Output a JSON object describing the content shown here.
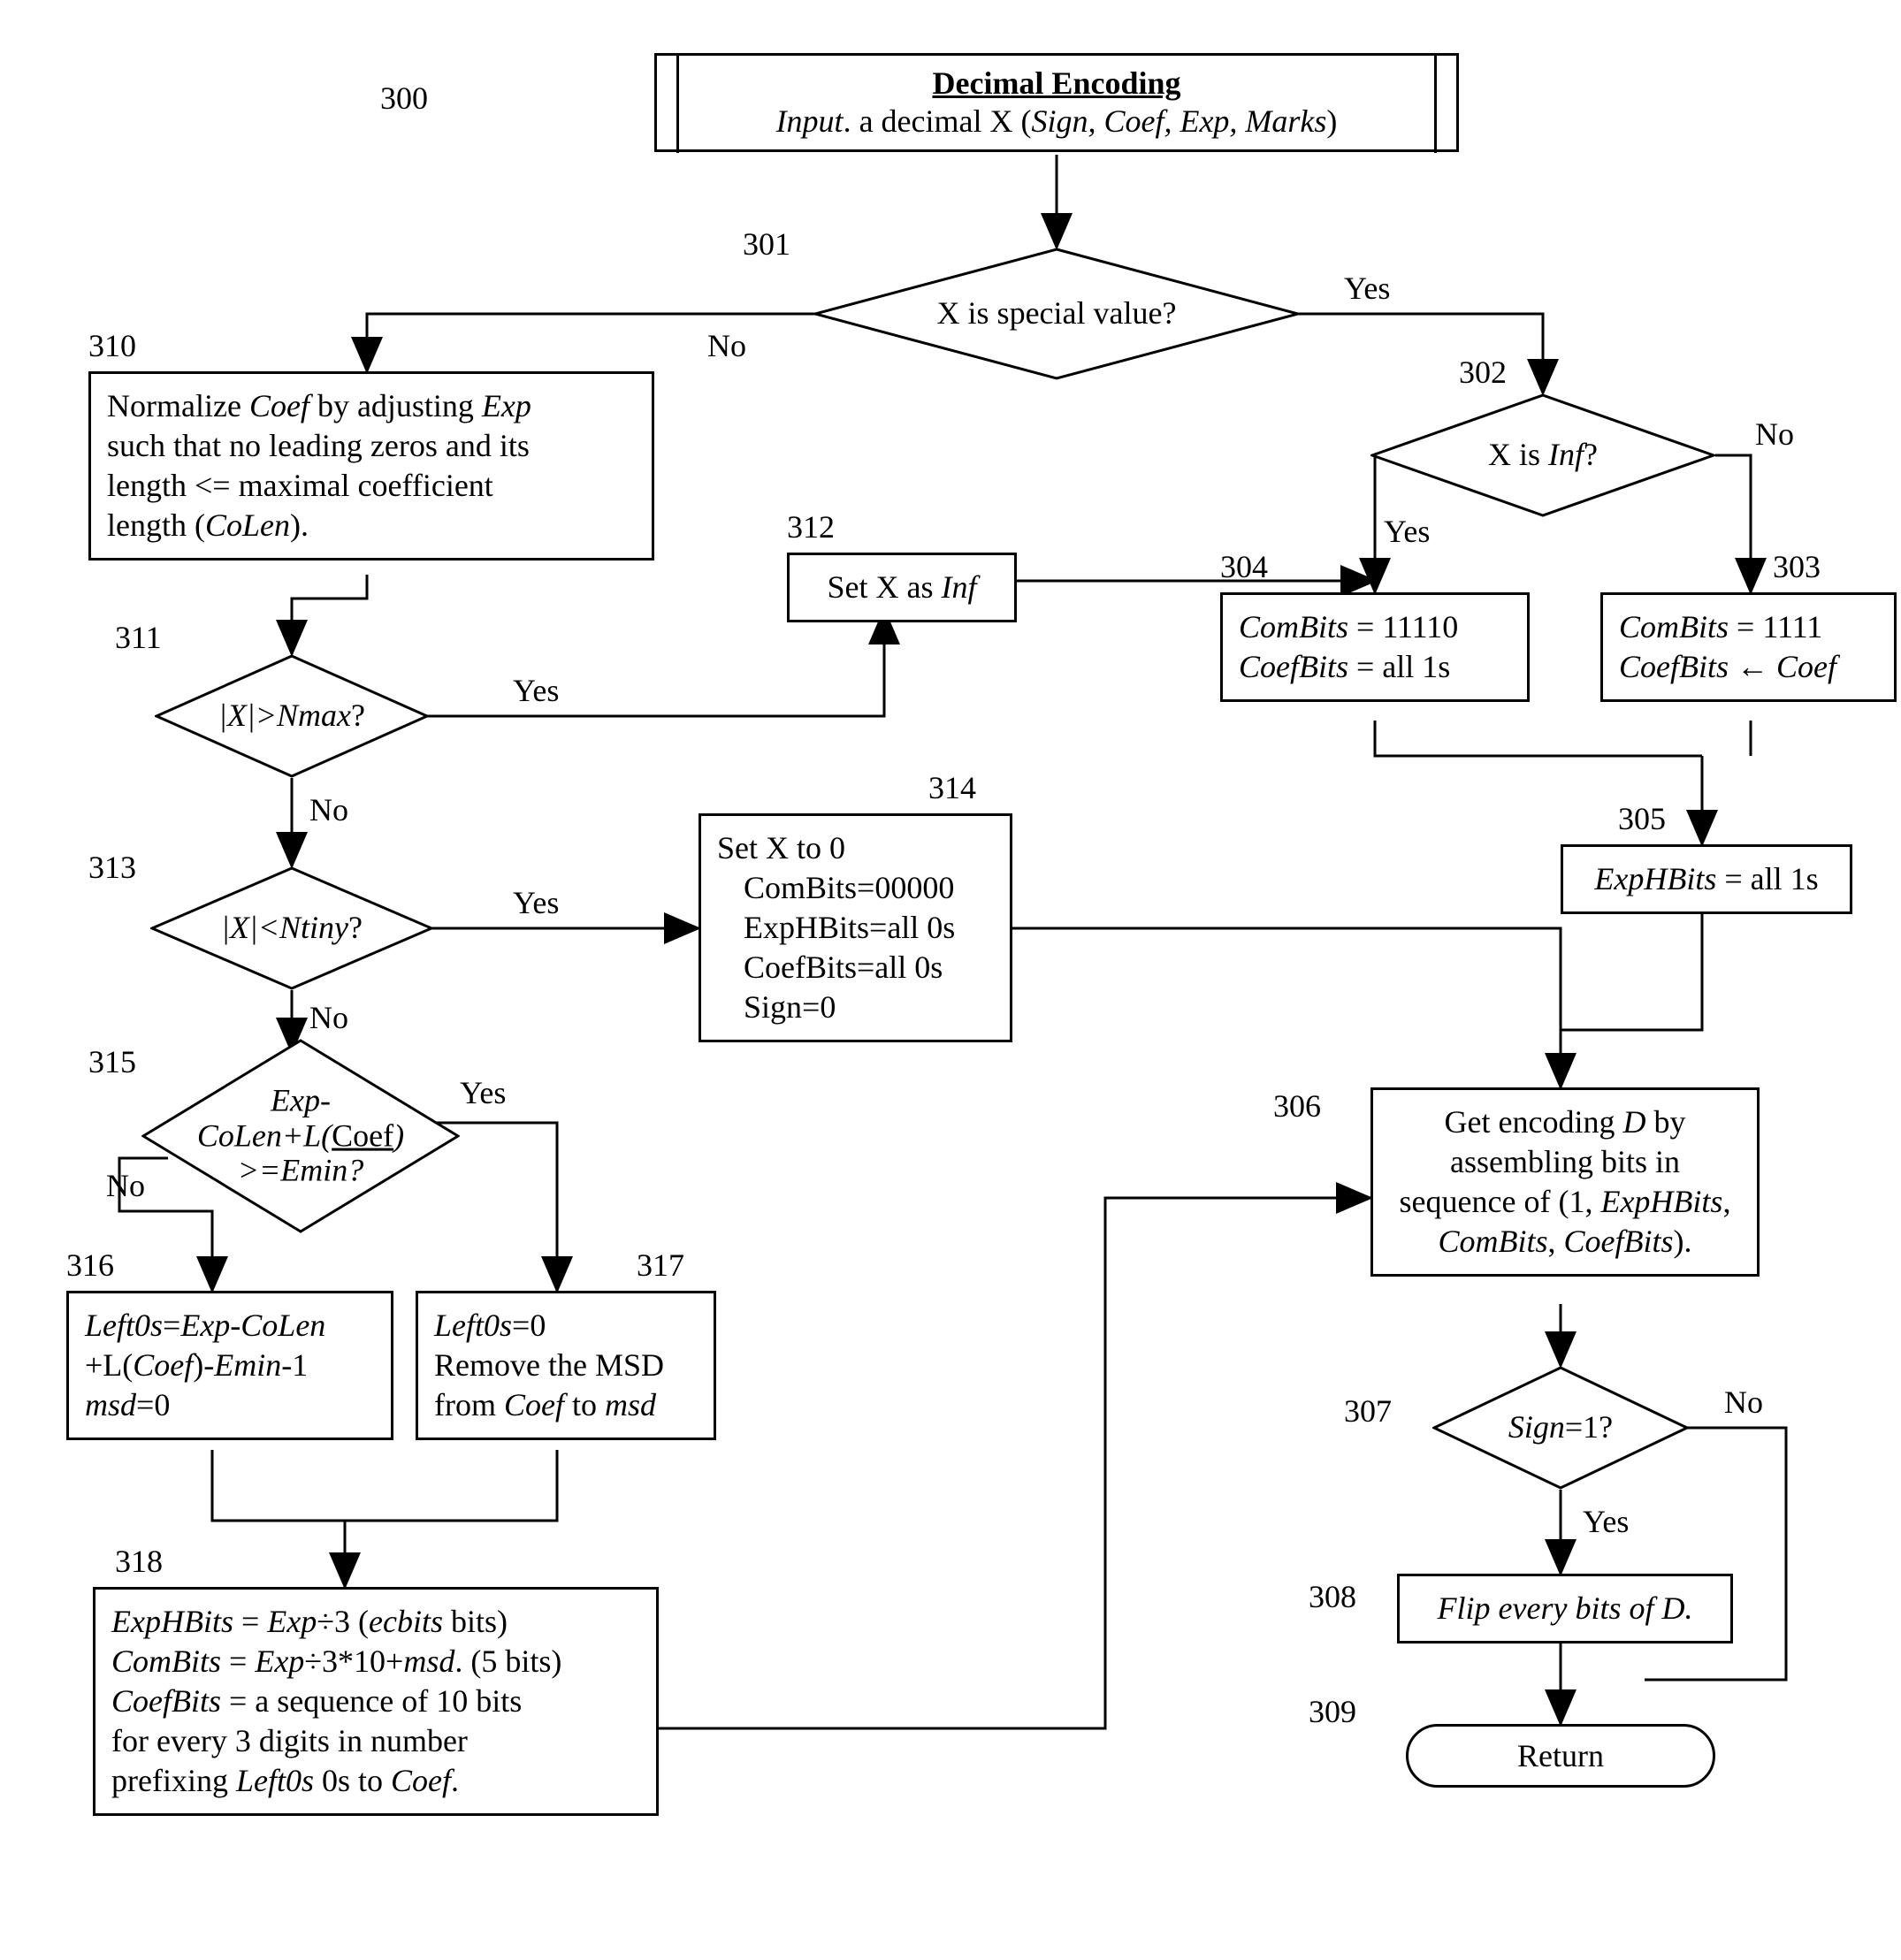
{
  "labels": {
    "n300": "300",
    "n301": "301",
    "n302": "302",
    "n303": "303",
    "n304": "304",
    "n305": "305",
    "n306": "306",
    "n307": "307",
    "n308": "308",
    "n309": "309",
    "n310": "310",
    "n311": "311",
    "n312": "312",
    "n313": "313",
    "n314": "314",
    "n315": "315",
    "n316": "316",
    "n317": "317",
    "n318": "318"
  },
  "start": {
    "title": "Decimal  Encoding",
    "input_prefix": "Input",
    "input_rest": ". a decimal X (",
    "input_params": "Sign, Coef, Exp, Marks",
    "input_close": ")"
  },
  "d301": {
    "text": "X is special value?"
  },
  "d302": {
    "text_pre": "X is ",
    "text_inf": "Inf",
    "text_q": "?"
  },
  "p304": {
    "l1a": "ComBits",
    "l1b": " = 11110",
    "l2a": "CoefBits",
    "l2b": " = all 1s"
  },
  "p303": {
    "l1a": "ComBits",
    "l1b": " = 1111",
    "l2a": "CoefBits",
    "l2arrow": " ←  ",
    "l2c": "Coef"
  },
  "p305": {
    "a": "ExpHBits",
    "b": " = all 1s"
  },
  "p306": {
    "t1": "Get encoding ",
    "t1i": "D",
    "t1b": " by",
    "t2": "assembling bits in",
    "t3a": "sequence of (1, ",
    "t3i1": "ExpHBits",
    "t3b": ",",
    "t4i1": "ComBits",
    "t4m": ", ",
    "t4i2": "CoefBits",
    "t4e": ")."
  },
  "d307": {
    "a": "Sign",
    "b": "=1?"
  },
  "p308": {
    "a": "Flip every bits of ",
    "b": "D."
  },
  "p309": {
    "t": "Return"
  },
  "p310": {
    "t1a": "Normalize ",
    "t1i1": "Coef",
    "t1b": " by adjusting ",
    "t1i2": "Exp",
    "t2": "such that no leading zeros and its",
    "t3": "length <= maximal coefficient",
    "t4a": "length (",
    "t4i": "CoLen",
    "t4b": ")."
  },
  "d311": {
    "a": "|X|>Nmax",
    "q": "?"
  },
  "p312": {
    "a": "Set X as ",
    "b": "Inf"
  },
  "d313": {
    "a": "|X|<Ntiny",
    "q": "?"
  },
  "p314": {
    "t1": "Set X to 0",
    "t2": "ComBits=00000",
    "t3": "ExpHBits=all 0s",
    "t4": "CoefBits=all 0s",
    "t5": "Sign=0"
  },
  "d315": {
    "l1": "Exp-",
    "l2a": "CoLen+L(",
    "l2u": "Coef",
    "l2b": ")",
    "l3": ">=Emin?"
  },
  "p316": {
    "l1a": "Left0s",
    "l1b": "=",
    "l1c": "Exp-CoLen",
    "l2a": "+L(",
    "l2i": "Coef",
    "l2b": ")-",
    "l2c": "Emin",
    "l2d": "-1",
    "l3a": "msd",
    "l3b": "=0"
  },
  "p317": {
    "l1a": "Left0s",
    "l1b": "=0",
    "l2": "Remove the MSD",
    "l3a": "from ",
    "l3i": "Coef",
    "l3b": " to ",
    "l3c": "msd"
  },
  "p318": {
    "l1a": "ExpHBits",
    "l1b": " = ",
    "l1c": "Exp",
    "l1d": "÷3 (",
    "l1e": "ecbits",
    "l1f": " bits)",
    "l2a": "ComBits",
    "l2b": " = ",
    "l2c": "Exp",
    "l2d": "÷3*10+",
    "l2e": "msd",
    "l2f": ". (5 bits)",
    "l3a": "CoefBits",
    "l3b": " = a sequence of 10 bits",
    "l4": "for every 3 digits in number",
    "l5a": "prefixing ",
    "l5i": "Left0s",
    "l5b": " 0s to ",
    "l5c": "Coef",
    "l5d": "."
  },
  "edges": {
    "yes": "Yes",
    "no": "No"
  }
}
